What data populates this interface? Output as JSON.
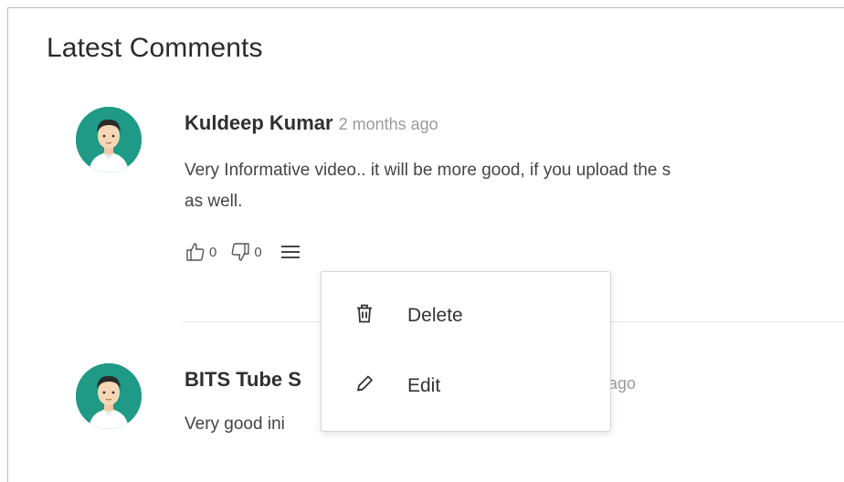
{
  "section": {
    "title": "Latest Comments"
  },
  "comments": [
    {
      "author": "Kuldeep Kumar",
      "time": "2 months ago",
      "text_line1": "Very Informative video.. it will be more good, if you upload the s",
      "text_line2": "as well.",
      "likes": "0",
      "dislikes": "0"
    },
    {
      "author": "BITS Tube S",
      "time": "ago",
      "text_line1": "Very good ini"
    }
  ],
  "menu": {
    "items": [
      {
        "label": "Delete",
        "icon": "trash-icon"
      },
      {
        "label": "Edit",
        "icon": "pencil-icon"
      }
    ]
  },
  "colors": {
    "avatar_bg": "#1e9a86",
    "muted_text": "#9a9a9a"
  }
}
